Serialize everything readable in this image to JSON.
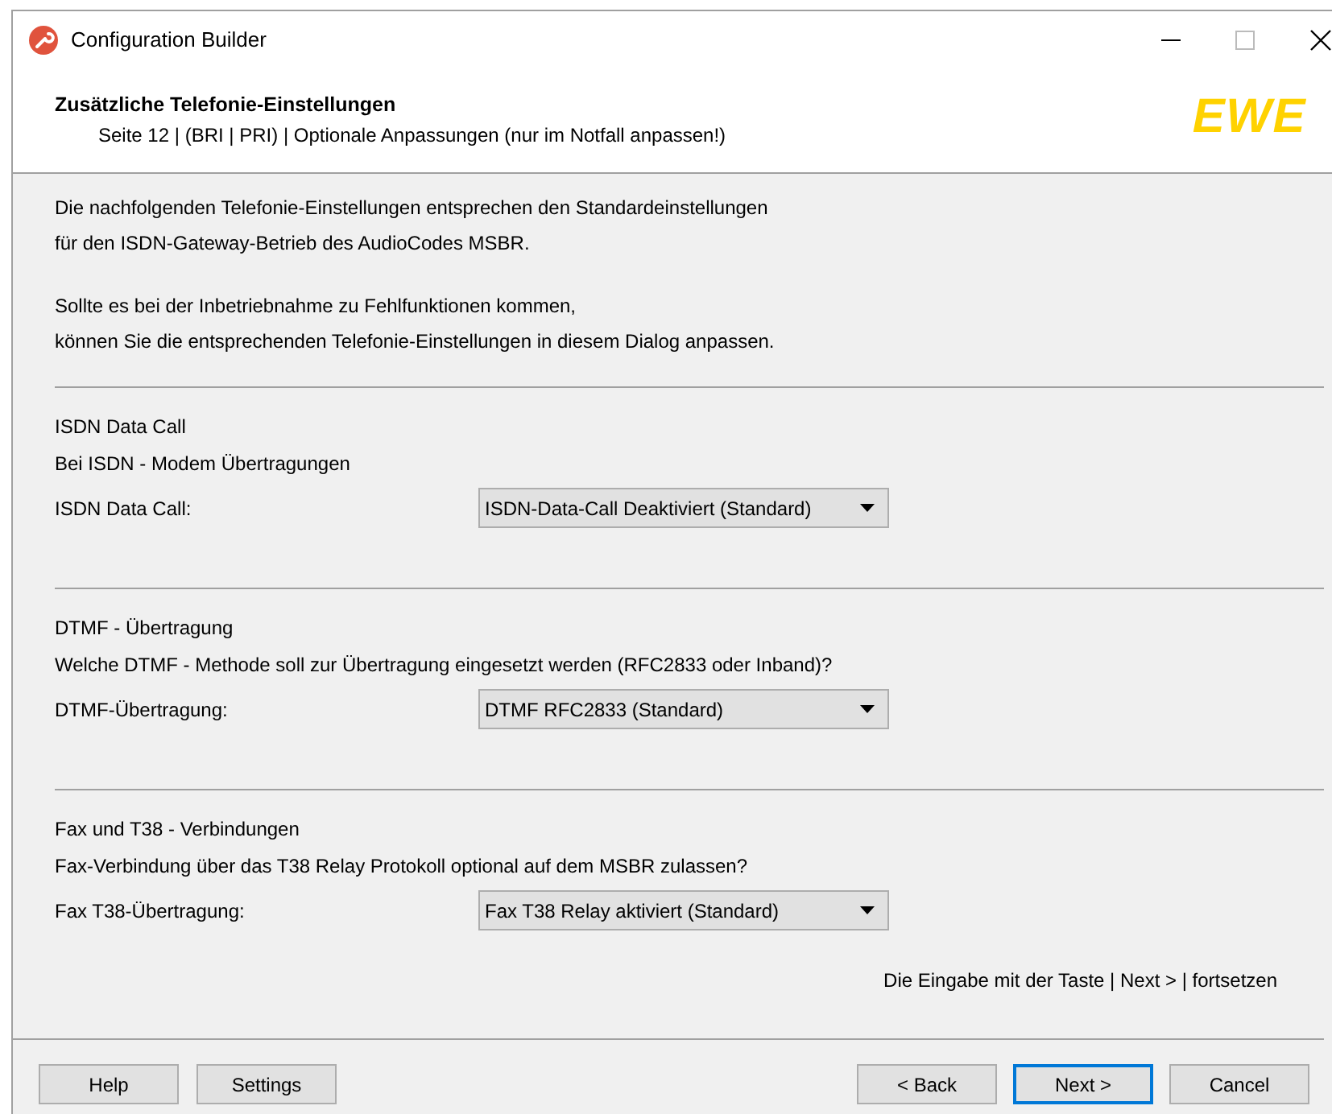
{
  "window": {
    "title": "Configuration Builder"
  },
  "header": {
    "title": "Zusätzliche Telefonie-Einstellungen",
    "subtitle": "Seite 12 | (BRI | PRI) | Optionale Anpassungen (nur im Notfall anpassen!)",
    "logo": "EWE"
  },
  "intro": [
    [
      "Die nachfolgenden Telefonie-Einstellungen entsprechen den Standardeinstellungen",
      "für den ISDN-Gateway-Betrieb des AudioCodes MSBR."
    ],
    [
      "Sollte es bei der Inbetriebnahme zu Fehlfunktionen kommen,",
      "können Sie die entsprechenden Telefonie-Einstellungen in diesem Dialog anpassen."
    ]
  ],
  "sections": [
    {
      "heading": "ISDN Data Call",
      "description": "Bei ISDN - Modem Übertragungen",
      "label": "ISDN Data Call:",
      "value": "ISDN-Data-Call Deaktiviert (Standard)"
    },
    {
      "heading": "DTMF - Übertragung",
      "description": "Welche DTMF - Methode soll zur Übertragung eingesetzt werden (RFC2833 oder Inband)?",
      "label": "DTMF-Übertragung:",
      "value": "DTMF RFC2833 (Standard)"
    },
    {
      "heading": "Fax und T38 - Verbindungen",
      "description": "Fax-Verbindung über das T38 Relay Protokoll optional auf dem MSBR zulassen?",
      "label": "Fax T38-Übertragung:",
      "value": "Fax T38 Relay aktiviert (Standard)"
    }
  ],
  "note": "Die Eingabe mit der Taste | Next > | fortsetzen",
  "buttons_left": [
    {
      "label": "Help",
      "default": false
    },
    {
      "label": "Settings",
      "default": false
    }
  ],
  "buttons_right": [
    {
      "label": "< Back",
      "default": false
    },
    {
      "label": "Next >",
      "default": true
    },
    {
      "label": "Cancel",
      "default": false
    }
  ]
}
